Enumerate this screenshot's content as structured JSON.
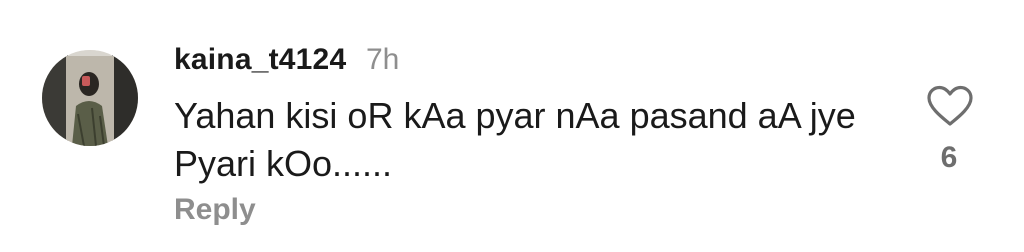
{
  "comment": {
    "username": "kaina_t4124",
    "time": "7h",
    "text": "Yahan kisi oR kAa pyar nAa pasand aA jye Pyari kOo......",
    "reply_label": "Reply",
    "like_count": "6",
    "avatar_icon": "user-avatar-photo",
    "like_icon": "heart-outline-icon"
  },
  "colors": {
    "primary_text": "#1a1a1a",
    "secondary_text": "#8e8e8e",
    "like_count_text": "#6e6e6e",
    "background": "#ffffff"
  }
}
